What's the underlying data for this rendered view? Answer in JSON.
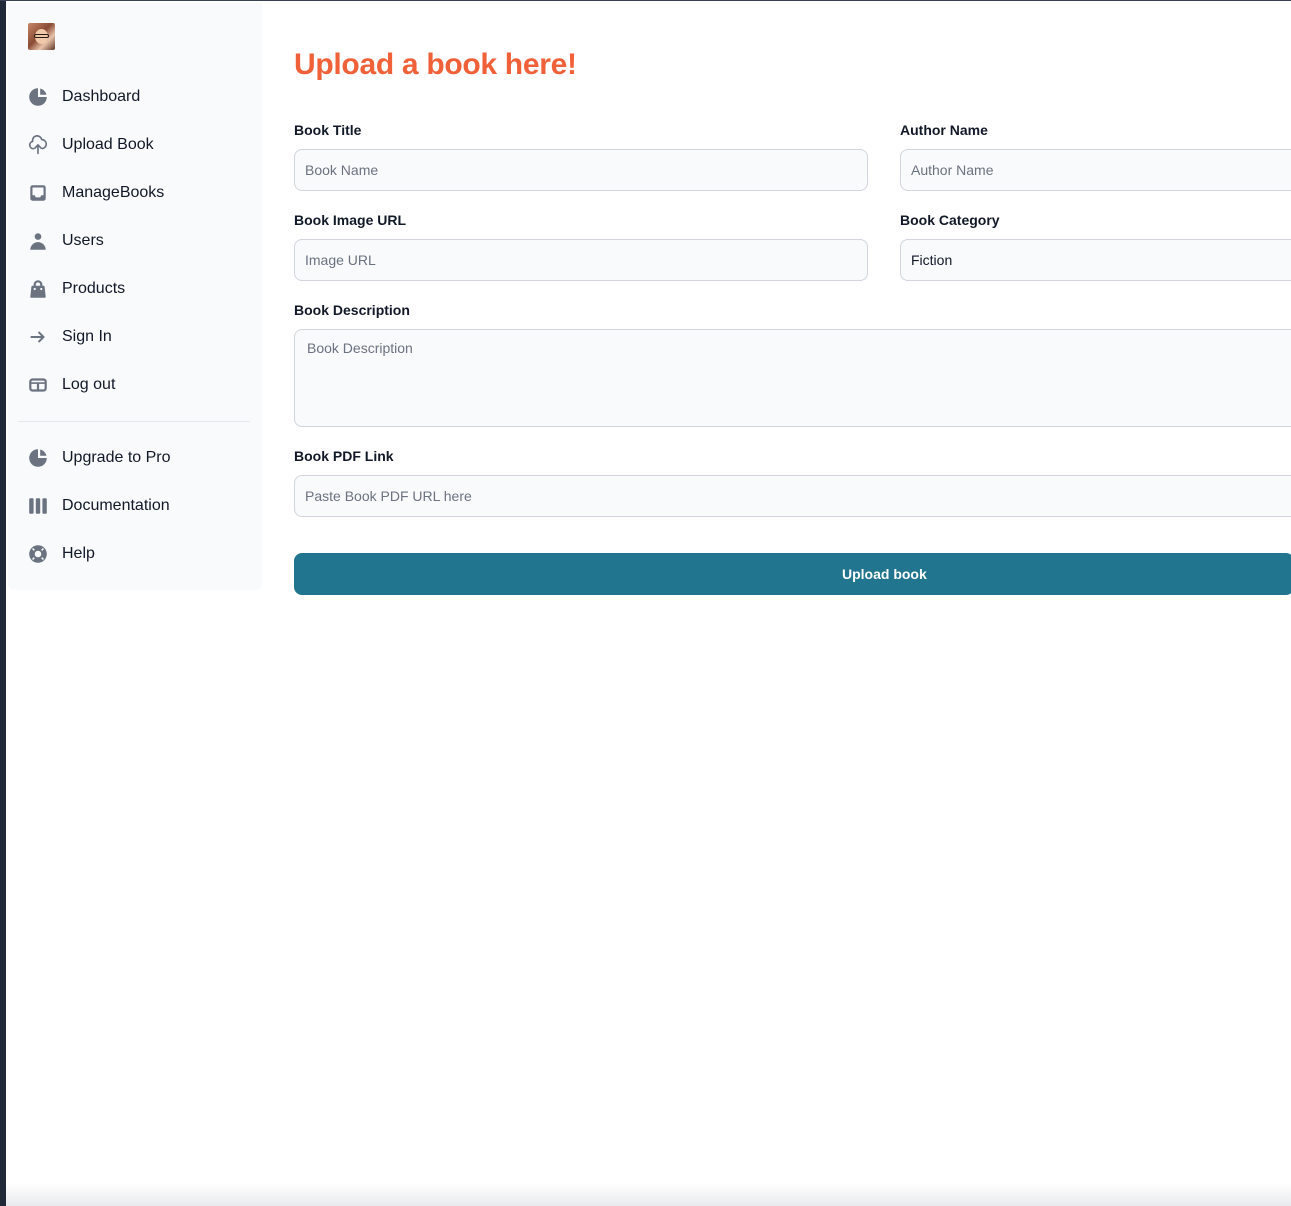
{
  "sidebar": {
    "items": [
      {
        "label": "Dashboard",
        "icon": "chart-pie-icon"
      },
      {
        "label": "Upload Book",
        "icon": "cloud-upload-icon"
      },
      {
        "label": "ManageBooks",
        "icon": "inbox-icon"
      },
      {
        "label": "Users",
        "icon": "user-icon"
      },
      {
        "label": "Products",
        "icon": "shopping-bag-icon"
      },
      {
        "label": "Sign In",
        "icon": "arrow-right-icon"
      },
      {
        "label": "Log out",
        "icon": "table-icon"
      }
    ],
    "secondary_items": [
      {
        "label": "Upgrade to Pro",
        "icon": "chart-pie-icon"
      },
      {
        "label": "Documentation",
        "icon": "view-boards-icon"
      },
      {
        "label": "Help",
        "icon": "support-icon"
      }
    ]
  },
  "form": {
    "title": "Upload a book here!",
    "title_color": "#f0613a",
    "book_title": {
      "label": "Book Title",
      "placeholder": "Book Name"
    },
    "author_name": {
      "label": "Author Name",
      "placeholder": "Author Name"
    },
    "book_image": {
      "label": "Book Image URL",
      "placeholder": "Image URL"
    },
    "book_category": {
      "label": "Book Category",
      "value": "Fiction"
    },
    "book_description": {
      "label": "Book Description",
      "placeholder": "Book Description"
    },
    "book_pdf": {
      "label": "Book PDF Link",
      "placeholder": "Paste Book PDF URL here"
    },
    "submit_label": "Upload book",
    "submit_color": "#21758e"
  }
}
